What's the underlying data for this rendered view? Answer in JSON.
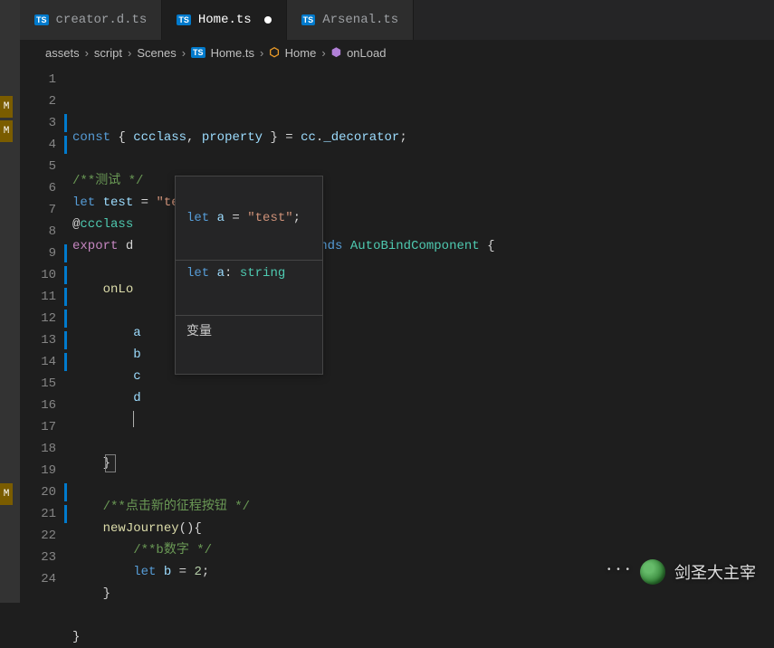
{
  "tabs": [
    {
      "label": "creator.d.ts",
      "active": false,
      "dirty": false
    },
    {
      "label": "Home.ts",
      "active": true,
      "dirty": true
    },
    {
      "label": "Arsenal.ts",
      "active": false,
      "dirty": false
    }
  ],
  "breadcrumb": {
    "segments": [
      "assets",
      "script",
      "Scenes",
      "Home.ts",
      "Home",
      "onLoad"
    ],
    "file_icon": "ts-icon",
    "class_icon": "class-icon",
    "method_icon": "cube-icon"
  },
  "strip_markers": [
    "M",
    "M",
    "M"
  ],
  "code": {
    "total_lines": 24,
    "modified_lines": [
      3,
      4,
      9,
      10,
      11,
      12,
      13,
      14,
      20,
      21
    ],
    "lines": {
      "1": {
        "tokens": [
          [
            "keyword",
            "const"
          ],
          [
            "punct",
            " { "
          ],
          [
            "var",
            "ccclass"
          ],
          [
            "punct",
            ", "
          ],
          [
            "var",
            "property"
          ],
          [
            "punct",
            " } = "
          ],
          [
            "var",
            "cc"
          ],
          [
            "punct",
            "."
          ],
          [
            "var",
            "_decorator"
          ],
          [
            "punct",
            ";"
          ]
        ]
      },
      "2": {
        "tokens": []
      },
      "3": {
        "tokens": [
          [
            "comment",
            "/**测试 */"
          ]
        ]
      },
      "4": {
        "tokens": [
          [
            "keyword",
            "let"
          ],
          [
            "punct",
            " "
          ],
          [
            "var",
            "test"
          ],
          [
            "punct",
            " = "
          ],
          [
            "string",
            "\"test\""
          ],
          [
            "punct",
            ";"
          ]
        ]
      },
      "5": {
        "tokens": [
          [
            "punct",
            "@"
          ],
          [
            "decor",
            "ccclass"
          ]
        ]
      },
      "6": {
        "left": [
          [
            "keyword-export",
            "export"
          ],
          [
            "punct",
            " d"
          ]
        ],
        "right": [
          [
            "punct",
            " "
          ],
          [
            "keyword",
            "extends"
          ],
          [
            "punct",
            " "
          ],
          [
            "class",
            "AutoBindComponent"
          ],
          [
            "punct",
            " {"
          ]
        ]
      },
      "7": {
        "tokens": []
      },
      "8": {
        "tokens": [
          [
            "punct",
            "    "
          ],
          [
            "func",
            "onLo"
          ]
        ]
      },
      "9": {
        "tokens": []
      },
      "10": {
        "tokens": [
          [
            "punct",
            "        "
          ],
          [
            "var",
            "a"
          ]
        ]
      },
      "11": {
        "tokens": [
          [
            "punct",
            "        "
          ],
          [
            "var",
            "b"
          ]
        ]
      },
      "12": {
        "tokens": [
          [
            "punct",
            "        "
          ],
          [
            "var",
            "c"
          ]
        ]
      },
      "13": {
        "tokens": [
          [
            "punct",
            "        "
          ],
          [
            "var",
            "d"
          ]
        ]
      },
      "14": {
        "tokens": [
          [
            "punct",
            "        "
          ]
        ],
        "cursor": true
      },
      "15": {
        "tokens": []
      },
      "16": {
        "tokens": [
          [
            "punct",
            "    "
          ],
          [
            "punct",
            "}"
          ]
        ],
        "box": true
      },
      "17": {
        "tokens": []
      },
      "18": {
        "tokens": [
          [
            "punct",
            "    "
          ],
          [
            "comment",
            "/**点击新的征程按钮 */"
          ]
        ]
      },
      "19": {
        "tokens": [
          [
            "punct",
            "    "
          ],
          [
            "func",
            "newJourney"
          ],
          [
            "punct",
            "(){"
          ]
        ]
      },
      "20": {
        "tokens": [
          [
            "punct",
            "        "
          ],
          [
            "comment",
            "/**b数字 */"
          ]
        ]
      },
      "21": {
        "tokens": [
          [
            "punct",
            "        "
          ],
          [
            "keyword",
            "let"
          ],
          [
            "punct",
            " "
          ],
          [
            "var",
            "b"
          ],
          [
            "punct",
            " = "
          ],
          [
            "number",
            "2"
          ],
          [
            "punct",
            ";"
          ]
        ]
      },
      "22": {
        "tokens": [
          [
            "punct",
            "    }"
          ]
        ]
      },
      "23": {
        "tokens": []
      },
      "24": {
        "tokens": [
          [
            "punct",
            "}"
          ]
        ]
      }
    }
  },
  "hover": {
    "def_tokens": [
      [
        "keyword",
        "let"
      ],
      [
        "punct",
        " "
      ],
      [
        "var",
        "a"
      ],
      [
        "punct",
        " = "
      ],
      [
        "string",
        "\"test\""
      ],
      [
        "punct",
        ";"
      ]
    ],
    "type_tokens": [
      [
        "keyword",
        "let"
      ],
      [
        "punct",
        " "
      ],
      [
        "var",
        "a"
      ],
      [
        "punct",
        ": "
      ],
      [
        "class",
        "string"
      ]
    ],
    "kind_label": "变量"
  },
  "watermark": {
    "text": "剑圣大主宰"
  }
}
